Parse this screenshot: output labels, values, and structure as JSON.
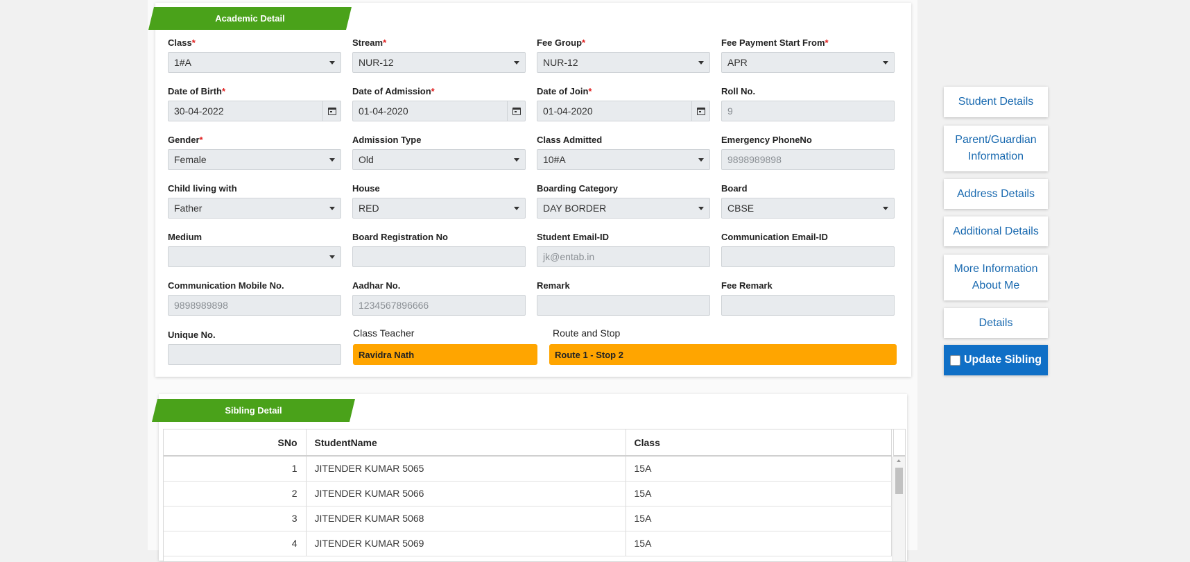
{
  "academic": {
    "title": "Academic Detail",
    "fields": {
      "class": {
        "label": "Class",
        "value": "1#A"
      },
      "stream": {
        "label": "Stream",
        "value": "NUR-12"
      },
      "fee_group": {
        "label": "Fee Group",
        "value": "NUR-12"
      },
      "fee_start": {
        "label": "Fee Payment Start From",
        "value": "APR"
      },
      "dob": {
        "label": "Date of Birth",
        "value": "30-04-2022"
      },
      "doa": {
        "label": "Date of Admission",
        "value": "01-04-2020"
      },
      "doj": {
        "label": "Date of Join",
        "value": "01-04-2020"
      },
      "roll": {
        "label": "Roll No.",
        "placeholder": "9"
      },
      "gender": {
        "label": "Gender",
        "value": "Female"
      },
      "admission_type": {
        "label": "Admission Type",
        "value": "Old"
      },
      "class_admitted": {
        "label": "Class Admitted",
        "value": "10#A"
      },
      "emergency_phone": {
        "label": "Emergency PhoneNo",
        "placeholder": "9898989898"
      },
      "child_living": {
        "label": "Child living with",
        "value": "Father"
      },
      "house": {
        "label": "House",
        "value": "RED"
      },
      "boarding": {
        "label": "Boarding Category",
        "value": "DAY BORDER"
      },
      "board": {
        "label": "Board",
        "value": "CBSE"
      },
      "medium": {
        "label": "Medium",
        "value": ""
      },
      "board_reg": {
        "label": "Board Registration No",
        "value": ""
      },
      "student_email": {
        "label": "Student Email-ID",
        "placeholder": "jk@entab.in"
      },
      "comm_email": {
        "label": "Communication Email-ID",
        "value": ""
      },
      "comm_mobile": {
        "label": "Communication Mobile No.",
        "placeholder": "9898989898"
      },
      "aadhar": {
        "label": "Aadhar No.",
        "placeholder": "1234567896666"
      },
      "remark": {
        "label": "Remark",
        "value": ""
      },
      "fee_remark": {
        "label": "Fee Remark",
        "value": ""
      },
      "unique_no": {
        "label": "Unique No.",
        "value": ""
      },
      "class_teacher": {
        "label": "Class Teacher",
        "value": "Ravidra Nath"
      },
      "route_stop": {
        "label": "Route and Stop",
        "value": "Route 1 - Stop 2"
      }
    },
    "required_mark": "*"
  },
  "sidebar": {
    "student_details": "Student Details",
    "parent_guardian": "Parent/Guardian Information",
    "address_details": "Address Details",
    "additional_details": "Additional Details",
    "more_info": "More Information About Me",
    "details": "Details",
    "update_sibling": "Update Sibling"
  },
  "sibling": {
    "title": "Sibling Detail",
    "columns": [
      "SNo",
      "StudentName",
      "Class"
    ],
    "rows": [
      [
        "1",
        "JITENDER KUMAR 5065",
        "15A"
      ],
      [
        "2",
        "JITENDER KUMAR 5066",
        "15A"
      ],
      [
        "3",
        "JITENDER KUMAR 5068",
        "15A"
      ],
      [
        "4",
        "JITENDER KUMAR 5069",
        "15A"
      ]
    ]
  },
  "colors": {
    "ribbon": "#4aa21a",
    "orange": "#ffa500",
    "link_blue": "#1a6ab0",
    "primary_blue": "#0f6fc6",
    "required": "#e02020"
  }
}
